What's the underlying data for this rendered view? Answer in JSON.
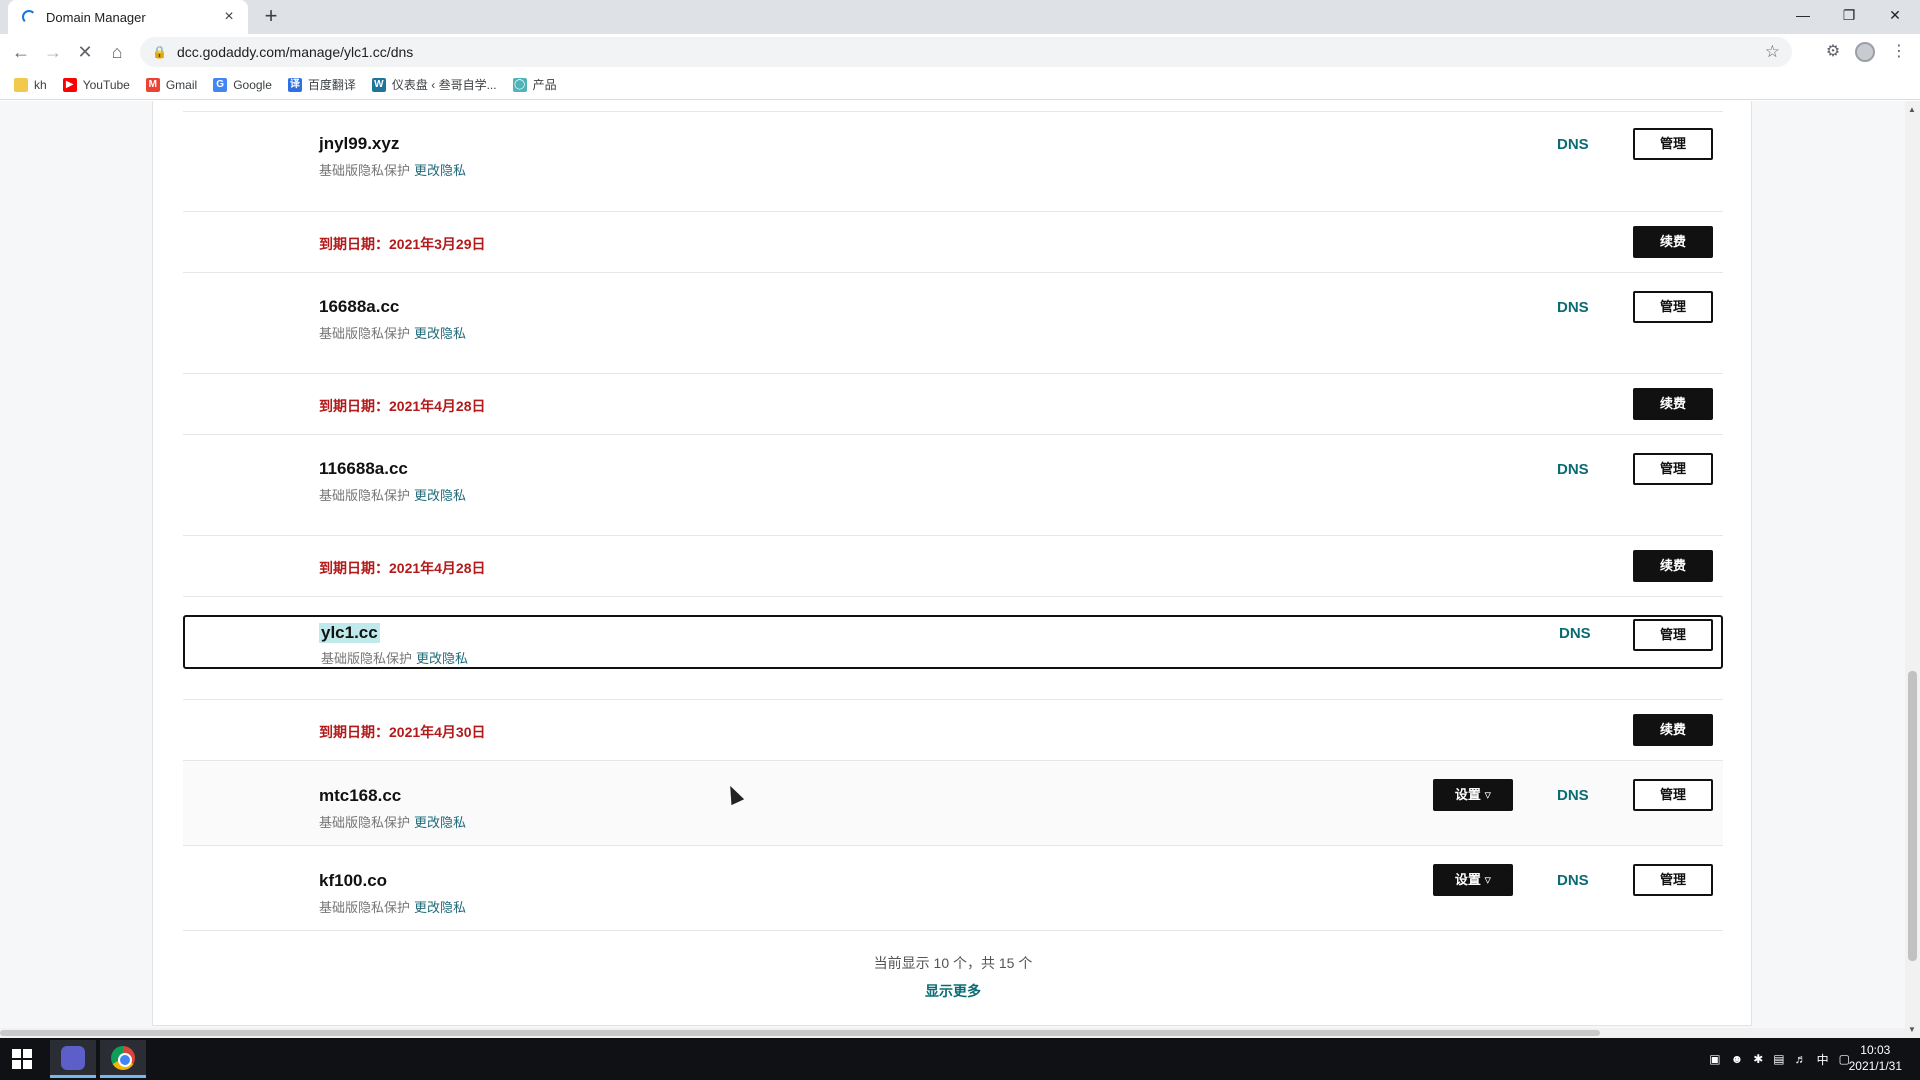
{
  "browser": {
    "tab_title": "Domain Manager",
    "tab_close": "×",
    "new_tab": "+",
    "url": "dcc.godaddy.com/manage/ylc1.cc/dns",
    "bookmarks": [
      {
        "label": "kh",
        "color": "#f2c94c"
      },
      {
        "label": "YouTube",
        "color": "#ff0000"
      },
      {
        "label": "Gmail",
        "color": "#ea4335"
      },
      {
        "label": "Google",
        "color": "#4285f4"
      },
      {
        "label": "百度翻译",
        "color": "#2f6fe4"
      },
      {
        "label": "仪表盘 ‹ 叁哥自学...",
        "color": "#21759b"
      },
      {
        "label": "产品",
        "color": "#4fb3b8"
      }
    ]
  },
  "domains": {
    "privacy_text": "基础版隐私保护",
    "privacy_link": "更改隐私",
    "dns_label": "DNS",
    "manage_label": "管理",
    "renew_label": "续费",
    "settings_label": "设置 ▿",
    "expiry_prefix": "到期日期：",
    "items": [
      {
        "name": "jnyl99.xyz",
        "expiry": "2021年3月29日"
      },
      {
        "name": "16688a.cc",
        "expiry": "2021年4月28日"
      },
      {
        "name": "116688a.cc",
        "expiry": "2021年4月28日"
      },
      {
        "name": "ylc1.cc",
        "expiry": "2021年4月30日"
      },
      {
        "name": "mtc168.cc"
      },
      {
        "name": "kf100.co"
      }
    ]
  },
  "pager": {
    "status": "当前显示 10 个，共 15 个",
    "show_more": "显示更多"
  },
  "taskbar": {
    "time": "10:03",
    "date": "2021/1/31",
    "ime": "中"
  },
  "colors": {
    "accent": "#0b6b74",
    "expiry": "#b31b1b",
    "selection": "#bfe9ea"
  }
}
